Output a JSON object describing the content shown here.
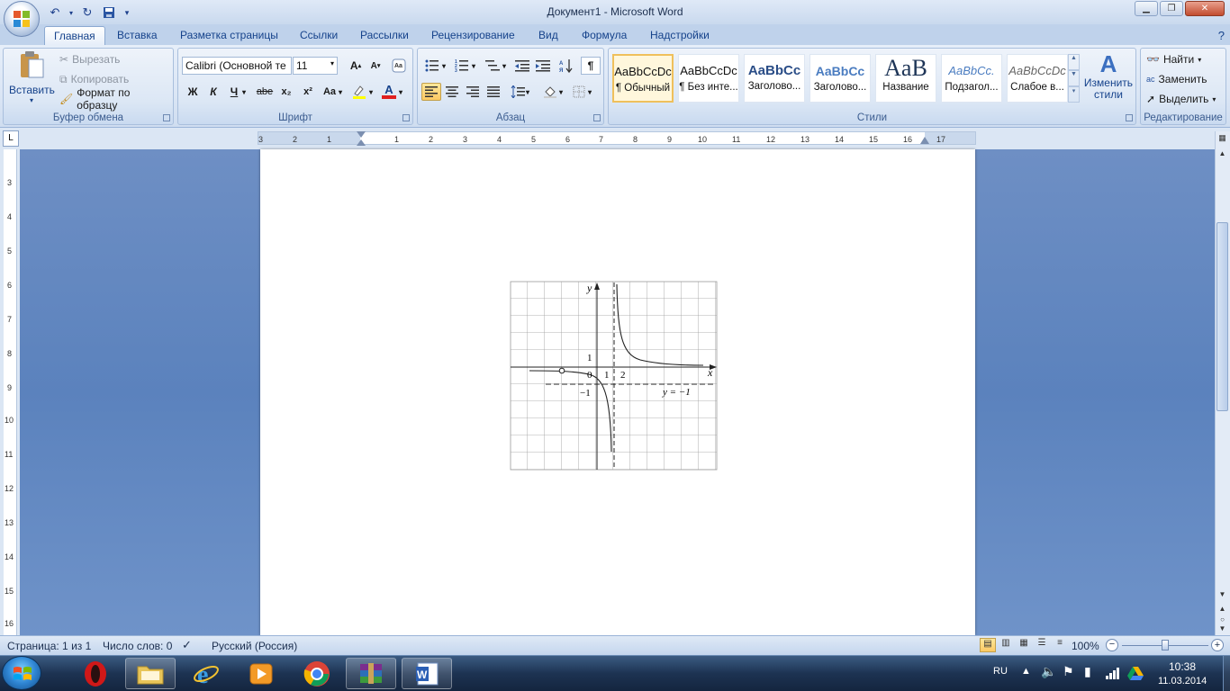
{
  "window": {
    "title": "Документ1 - Microsoft Word"
  },
  "tabs": [
    "Главная",
    "Вставка",
    "Разметка страницы",
    "Ссылки",
    "Рассылки",
    "Рецензирование",
    "Вид",
    "Формула",
    "Надстройки"
  ],
  "clipboard": {
    "paste": "Вставить",
    "cut": "Вырезать",
    "copy": "Копировать",
    "format_painter": "Формат по образцу",
    "label": "Буфер обмена"
  },
  "font": {
    "name": "Calibri (Основной те",
    "size": "11",
    "label": "Шрифт",
    "bold": "Ж",
    "italic": "К",
    "underline": "Ч",
    "strike": "abe",
    "sub": "x₂",
    "sup": "x²",
    "case": "Aa"
  },
  "paragraph": {
    "label": "Абзац"
  },
  "styles": {
    "label": "Стили",
    "items": [
      {
        "sample": "AaBbCcDc",
        "name": "¶ Обычный"
      },
      {
        "sample": "AaBbCcDc",
        "name": "¶ Без инте..."
      },
      {
        "sample": "AaBbCc",
        "name": "Заголово..."
      },
      {
        "sample": "AaBbCc",
        "name": "Заголово..."
      },
      {
        "sample": "AaB",
        "name": "Название"
      },
      {
        "sample": "AaBbCc.",
        "name": "Подзагол..."
      },
      {
        "sample": "AaBbCcDc",
        "name": "Слабое в..."
      }
    ],
    "change_line1": "Изменить",
    "change_line2": "стили"
  },
  "editing": {
    "find": "Найти",
    "replace": "Заменить",
    "select": "Выделить",
    "label": "Редактирование"
  },
  "ruler": {
    "h_ticks": [
      "3",
      "2",
      "1",
      "1",
      "2",
      "3",
      "4",
      "5",
      "6",
      "7",
      "8",
      "9",
      "10",
      "11",
      "12",
      "13",
      "14",
      "15",
      "16",
      "17"
    ],
    "v_ticks": [
      "3",
      "4",
      "5",
      "6",
      "7",
      "8",
      "9",
      "10",
      "11",
      "12",
      "13",
      "14",
      "15",
      "16"
    ],
    "corner": "L"
  },
  "graph": {
    "y_axis": "y",
    "x_axis": "x",
    "label_1": "1",
    "label_0": "0",
    "label_neg1": "−1",
    "label_x1": "1",
    "label_x2": "2",
    "asymptote": "y = −1"
  },
  "status": {
    "page": "Страница: 1 из 1",
    "words": "Число слов: 0",
    "language": "Русский (Россия)",
    "zoom": "100%"
  },
  "tray": {
    "lang": "RU",
    "time": "10:38",
    "date": "11.03.2014"
  },
  "colors": {
    "accent": "#15428b",
    "workspace": "#6e8fc4",
    "font_color": "#e02020",
    "highlight": "#ffff00"
  }
}
